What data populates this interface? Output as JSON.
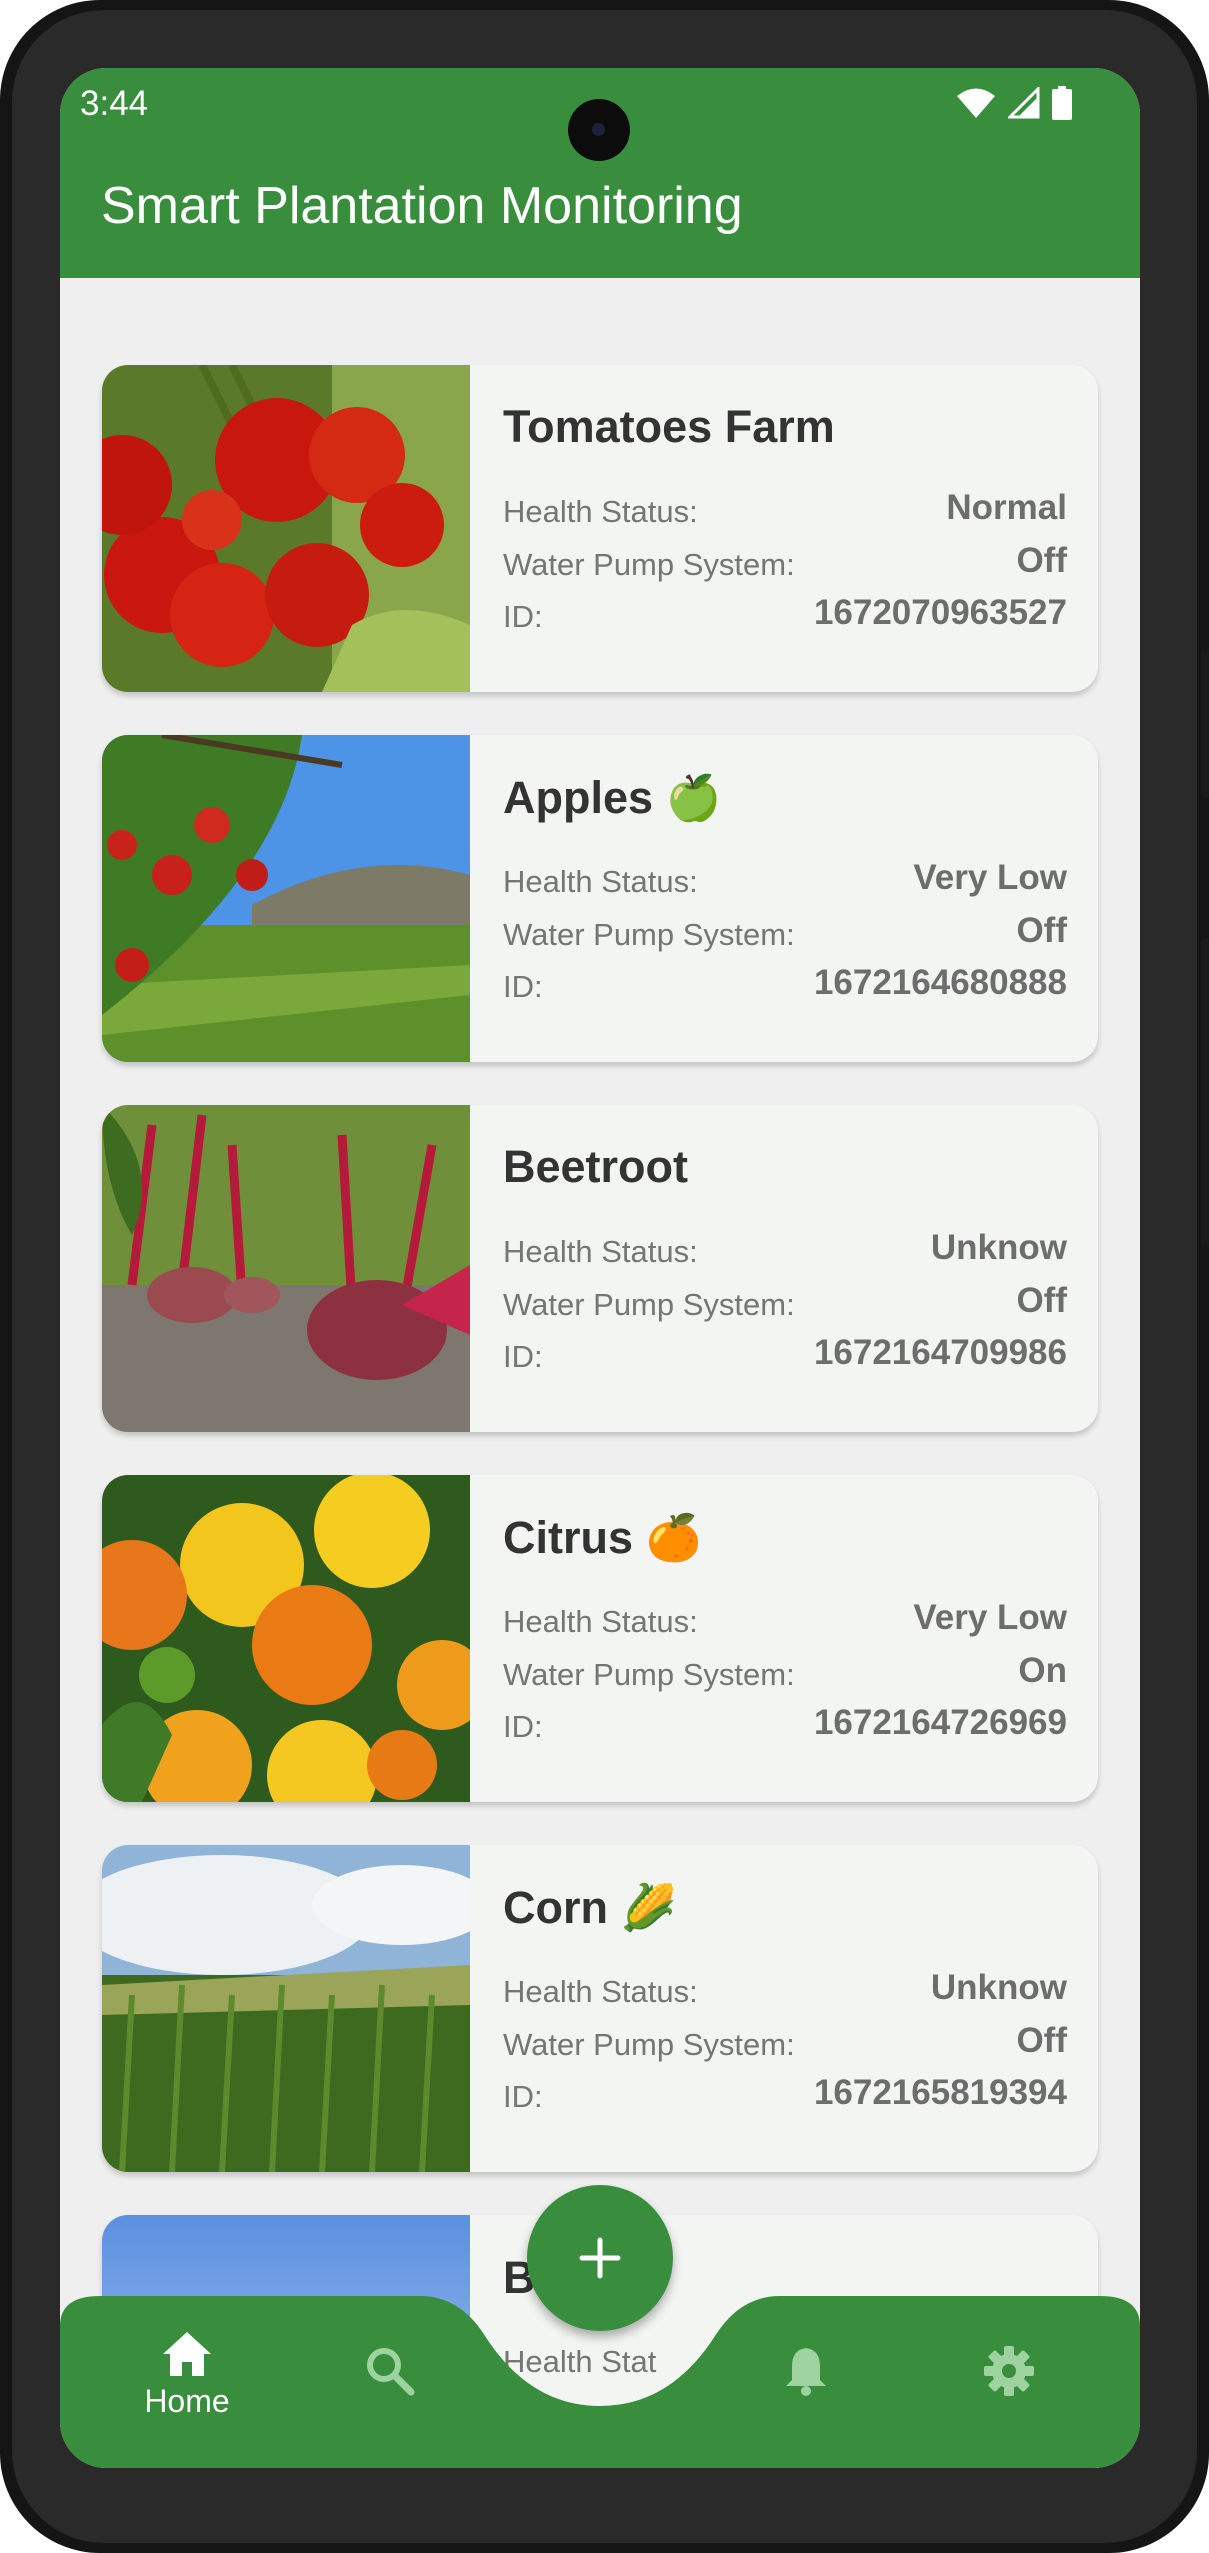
{
  "status_bar": {
    "time": "3:44"
  },
  "app": {
    "title": "Smart Plantation Monitoring"
  },
  "labels": {
    "health": "Health Status:",
    "pump": "Water Pump System:",
    "id": "ID:"
  },
  "cards": [
    {
      "title": "Tomatoes Farm",
      "emoji": "",
      "health": "Normal",
      "pump": "Off",
      "id": "1672070963527"
    },
    {
      "title": "Apples",
      "emoji": "🍏",
      "health": "Very Low",
      "pump": "Off",
      "id": "1672164680888"
    },
    {
      "title": "Beetroot",
      "emoji": "",
      "health": "Unknow",
      "pump": "Off",
      "id": "1672164709986"
    },
    {
      "title": "Citrus",
      "emoji": "🍊",
      "health": "Very Low",
      "pump": "On",
      "id": "1672164726969"
    },
    {
      "title": "Corn",
      "emoji": "🌽",
      "health": "Unknow",
      "pump": "Off",
      "id": "1672165819394"
    },
    {
      "title_partial": "B",
      "emoji": "🫘",
      "health_label_partial": "Health Stat"
    }
  ],
  "nav": {
    "home_label": "Home",
    "icons": [
      "home-icon",
      "search-icon",
      "bell-icon",
      "gear-icon"
    ],
    "active": "Home"
  },
  "fab": {
    "icon": "plus-icon"
  },
  "colors": {
    "primary": "#388e3c",
    "card": "#f2f5f2",
    "background": "#efefef"
  }
}
